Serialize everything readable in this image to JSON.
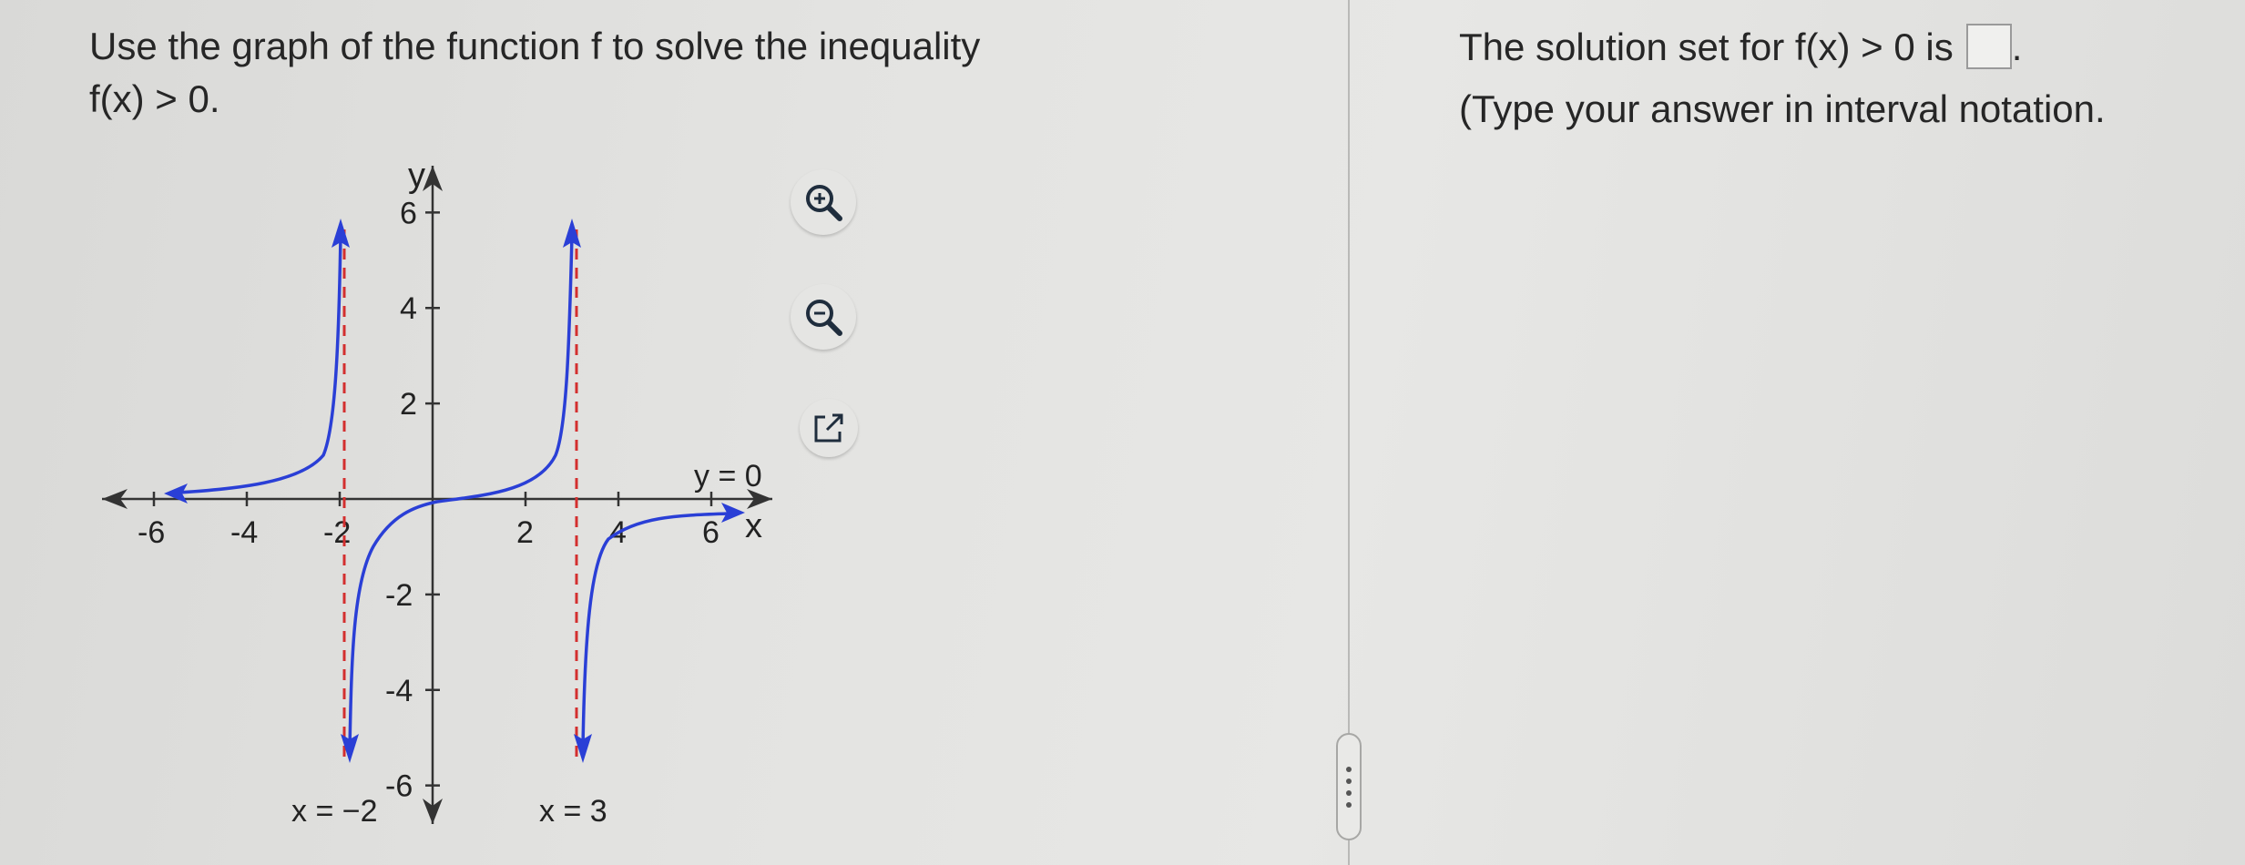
{
  "question": {
    "line1": "Use the graph of the function f to solve the inequality",
    "line2": "f(x) > 0."
  },
  "graph": {
    "y_axis_label": "y",
    "x_axis_label": "x",
    "x_ticks": [
      "-6",
      "-4",
      "-2",
      "2",
      "4",
      "6"
    ],
    "y_ticks": [
      "6",
      "4",
      "2",
      "-2",
      "-4",
      "-6"
    ],
    "asymptote_left_label": "x = −2",
    "asymptote_right_label": "x = 3",
    "horizontal_asymptote_label": "y = 0",
    "curve_color": "#2a3fd6",
    "asymptote_color": "#d32f2f"
  },
  "tools": {
    "zoom_in": "zoom-in-icon",
    "zoom_out": "zoom-out-icon",
    "open_external": "external-link-icon"
  },
  "answer": {
    "prefix": "The solution set for f(x) > 0 is",
    "suffix": ".",
    "value": "",
    "hint": "(Type your answer in interval notation."
  }
}
